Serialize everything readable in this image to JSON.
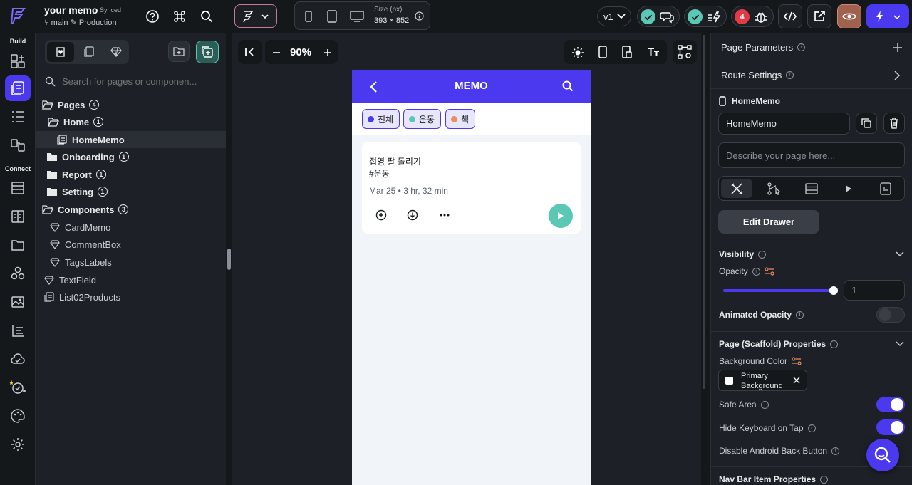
{
  "project": {
    "title": "your memo",
    "sync_status": "Synced",
    "branch": "main",
    "environment": "Production"
  },
  "toolbar": {
    "size_label": "Size (px)",
    "size_value": "393 × 852",
    "version": "v1",
    "error_count": "4"
  },
  "rail": {
    "build_label": "Build",
    "connect_label": "Connect"
  },
  "left_panel": {
    "search_placeholder": "Search for pages or componen...",
    "tree": {
      "pages_label": "Pages",
      "pages_count": "4",
      "home_label": "Home",
      "home_count": "1",
      "homememo_label": "HomeMemo",
      "onboarding_label": "Onboarding",
      "onboarding_count": "1",
      "report_label": "Report",
      "report_count": "1",
      "setting_label": "Setting",
      "setting_count": "1",
      "components_label": "Components",
      "components_count": "3",
      "cardmemo_label": "CardMemo",
      "commentbox_label": "CommentBox",
      "tagslabels_label": "TagsLabels",
      "textfield_label": "TextField",
      "list02products_label": "List02Products"
    }
  },
  "canvas": {
    "zoom": "90%"
  },
  "phone": {
    "title": "MEMO",
    "chips": [
      {
        "label": "전체",
        "dot_color": "#4b39ef"
      },
      {
        "label": "운동",
        "dot_color": "#5ac8b5"
      },
      {
        "label": "책",
        "dot_color": "#ee8b60"
      }
    ],
    "card": {
      "title": "접영 팔 돌리기",
      "tag": "#운동",
      "meta": "Mar 25 • 3 hr, 32 min"
    }
  },
  "right_panel": {
    "page_parameters": "Page Parameters",
    "route_settings": "Route Settings",
    "page_name_heading": "HomeMemo",
    "page_name_value": "HomeMemo",
    "description_placeholder": "Describe your page here...",
    "edit_drawer": "Edit Drawer",
    "visibility": "Visibility",
    "opacity": "Opacity",
    "opacity_value": "1",
    "animated_opacity": "Animated Opacity",
    "scaffold_props": "Page (Scaffold) Properties",
    "background_color": "Background Color",
    "bg_color_line1": "Primary",
    "bg_color_line2": "Background",
    "safe_area": "Safe Area",
    "hide_keyboard": "Hide Keyboard on Tap",
    "disable_back": "Disable Android Back Button",
    "nav_bar_props": "Nav Bar Item Properties"
  },
  "colors": {
    "accent": "#4b39ef",
    "teal": "#5ac8b5",
    "error": "#e63946"
  }
}
